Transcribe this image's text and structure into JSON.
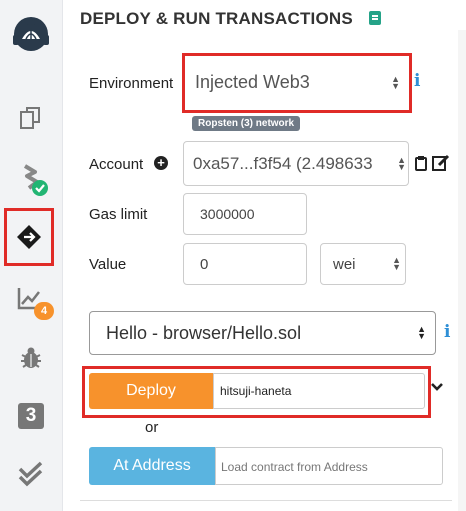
{
  "sidebar": {
    "items": [
      {
        "name": "remix-logo",
        "label": ""
      },
      {
        "name": "file-explorer-icon"
      },
      {
        "name": "compiler-icon"
      },
      {
        "name": "deploy-run-icon"
      },
      {
        "name": "analysis-icon",
        "badge": "4"
      },
      {
        "name": "debugger-icon"
      },
      {
        "name": "plugin-icon",
        "label": "3"
      },
      {
        "name": "test-icon"
      }
    ]
  },
  "header": {
    "title": "DEPLOY & RUN TRANSACTIONS"
  },
  "environment": {
    "label": "Environment",
    "value": "Injected Web3",
    "network_badge": "Ropsten (3) network",
    "info": "i"
  },
  "account": {
    "label": "Account",
    "value": "0xa57...f3f54 (2.498633"
  },
  "gas_limit": {
    "label": "Gas limit",
    "value": "3000000"
  },
  "value": {
    "label": "Value",
    "amount": "0",
    "unit": "wei"
  },
  "contract": {
    "value": "Hello - browser/Hello.sol",
    "info": "i"
  },
  "deploy": {
    "button_label": "Deploy",
    "arg_value": "hitsuji-haneta"
  },
  "or_label": "or",
  "at_address": {
    "button_label": "At Address",
    "placeholder": "Load contract from Address"
  },
  "colors": {
    "deploy_orange": "#f7922c",
    "at_address_blue": "#5ab4e0",
    "highlight_red": "#e02b27",
    "check_green": "#22b573",
    "badge_orange": "#f7922c"
  }
}
